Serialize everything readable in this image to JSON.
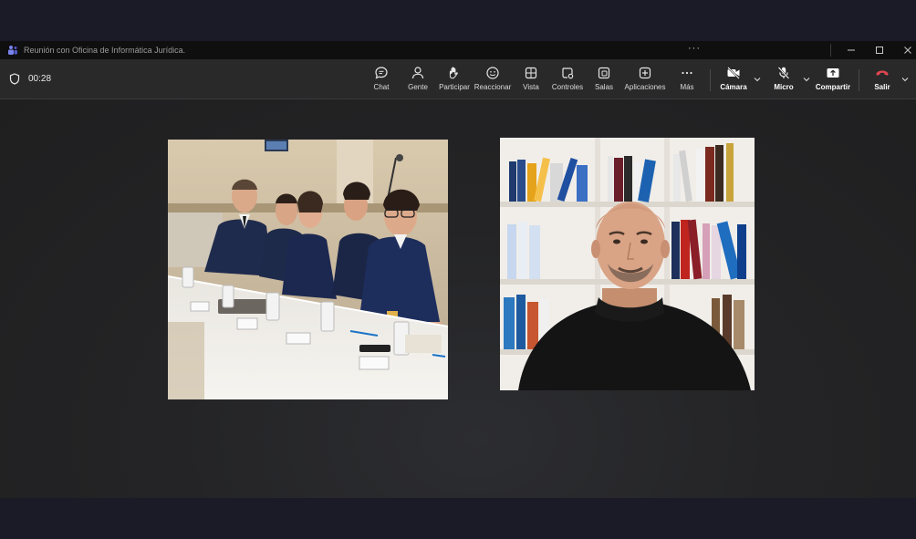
{
  "window": {
    "title": "Reunión con Oficina de Informática Jurídica.",
    "more_glyph": "···",
    "controls": [
      "minimize-icon",
      "maximize-icon",
      "close-icon"
    ]
  },
  "meeting": {
    "timer": "00:28"
  },
  "toolbar": {
    "chat": "Chat",
    "people": "Gente",
    "raise": "Participar",
    "react": "Reaccionar",
    "view": "Vista",
    "controls": "Controles",
    "rooms": "Salas",
    "apps": "Aplicaciones",
    "more": "Más",
    "camera": "Cámara",
    "mic": "Micro",
    "share": "Compartir",
    "leave": "Salir"
  },
  "colors": {
    "toolbar_bg": "#292929",
    "titlebar_bg": "#0f0f10",
    "stage_bg": "#232325",
    "leave_red": "#e0464f",
    "teams_purple": "#7b83eb"
  },
  "participants": [
    {
      "video": "group-photo-officers"
    },
    {
      "video": "man-with-bookshelf"
    }
  ]
}
